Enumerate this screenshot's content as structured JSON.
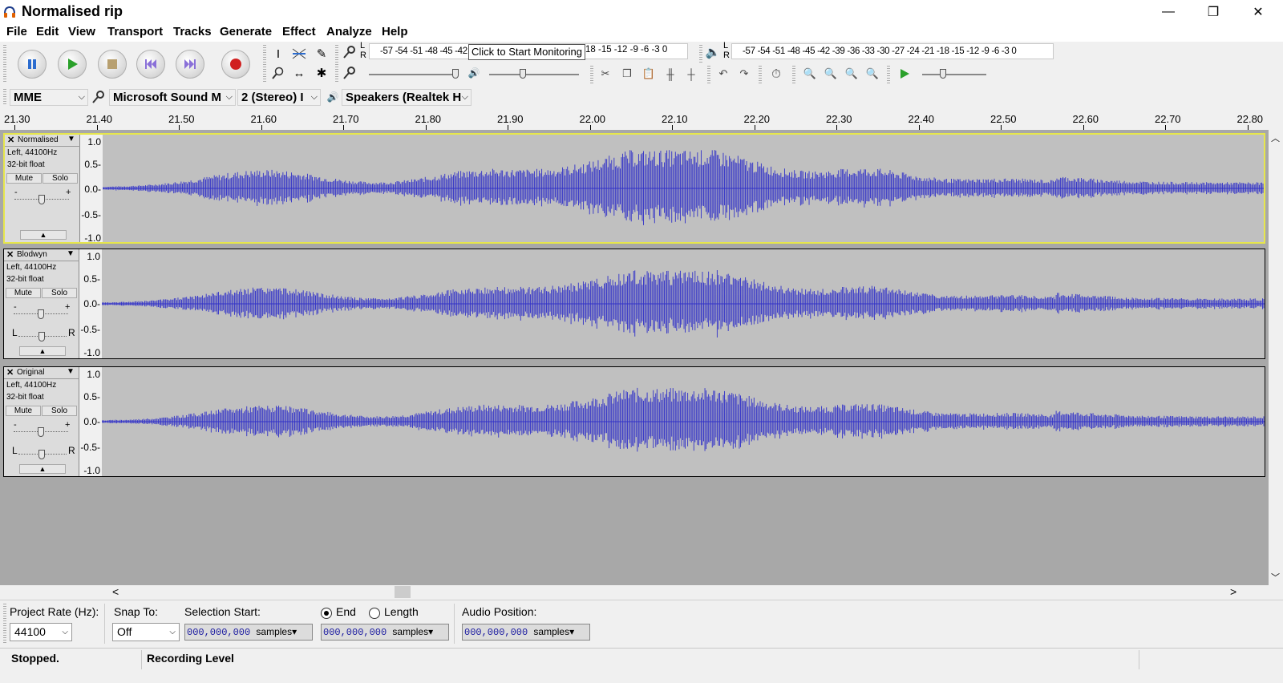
{
  "window": {
    "title": "Normalised rip",
    "minimize_glyph": "—",
    "maximize_glyph": "❐",
    "close_glyph": "✕"
  },
  "menu": [
    "File",
    "Edit",
    "View",
    "Transport",
    "Tracks",
    "Generate",
    "Effect",
    "Analyze",
    "Help"
  ],
  "meters": {
    "record_scale": "-57 -54 -51 -48 -45 -42",
    "tooltip": "Click to Start Monitoring",
    "record_scale_tail": "18 -15 -12  -9  -6  -3  0",
    "playback_scale": "-57 -54 -51 -48 -45 -42 -39 -36 -33 -30 -27 -24 -21 -18 -15 -12  -9  -6  -3  0",
    "lr_label_l": "L",
    "lr_label_r": "R"
  },
  "device": {
    "host": "MME",
    "input": "Microsoft Sound M",
    "channels": "2 (Stereo) I",
    "output": "Speakers (Realtek H"
  },
  "ruler": {
    "labels": [
      "21.30",
      "21.40",
      "21.50",
      "21.60",
      "21.70",
      "21.80",
      "21.90",
      "22.00",
      "22.10",
      "22.20",
      "22.30",
      "22.40",
      "22.50",
      "22.60",
      "22.70",
      "22.80"
    ]
  },
  "tracks": [
    {
      "name": "Normalised",
      "info1": "Left, 44100Hz",
      "info2": "32-bit float",
      "mute": "Mute",
      "solo": "Solo",
      "selected": true,
      "pan": false,
      "scale": [
        "1.0",
        "0.5-",
        "0.0-",
        "-0.5-",
        "-1.0"
      ],
      "amp": 0.72
    },
    {
      "name": "Blodwyn",
      "info1": "Left, 44100Hz",
      "info2": "32-bit float",
      "mute": "Mute",
      "solo": "Solo",
      "selected": false,
      "pan": true,
      "scale": [
        "1.0",
        "0.5-",
        "0.0-",
        "-0.5-",
        "-1.0"
      ],
      "amp": 0.62
    },
    {
      "name": "Original",
      "info1": "Left, 44100Hz",
      "info2": "32-bit float",
      "mute": "Mute",
      "solo": "Solo",
      "selected": false,
      "pan": true,
      "scale": [
        "1.0",
        "0.5-",
        "0.0-",
        "-0.5-",
        "-1.0"
      ],
      "amp": 0.62
    }
  ],
  "track_labels": {
    "gain_minus": "-",
    "gain_plus": "+",
    "pan_l": "L",
    "pan_r": "R",
    "close": "✕",
    "dropdown": "▼",
    "collapse": "▲"
  },
  "selection": {
    "project_rate_label": "Project Rate (Hz):",
    "project_rate": "44100",
    "snap_label": "Snap To:",
    "snap_value": "Off",
    "start_label": "Selection Start:",
    "start_value": "000,000,000",
    "end_label": "End",
    "length_label": "Length",
    "end_value": "000,000,000",
    "position_label": "Audio Position:",
    "position_value": "000,000,000",
    "unit": "samples"
  },
  "status": {
    "state": "Stopped.",
    "meter": "Recording Level"
  },
  "colors": {
    "waveform": "#3232c8",
    "selected_border": "#e6e64c",
    "track_bg": "#c0c0c0"
  }
}
